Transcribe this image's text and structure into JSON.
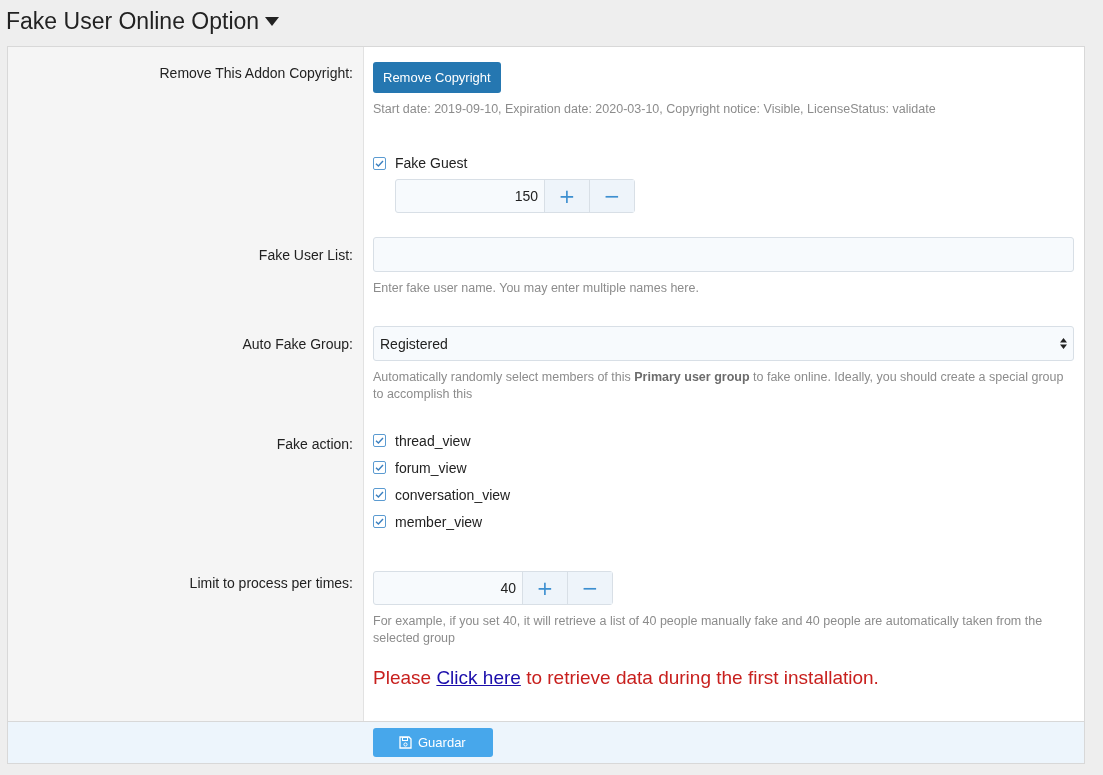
{
  "title": "Fake User Online Option",
  "rows": [
    {
      "kind": "button",
      "label": "Remove This Addon Copyright:",
      "button": "Remove Copyright",
      "hint": "Start date: 2019-09-10, Expiration date: 2020-03-10, Copyright notice: Visible, LicenseStatus: validate"
    },
    {
      "kind": "checkbox_number",
      "checkbox": {
        "label": "Fake Guest",
        "checked": true
      },
      "value": "150",
      "plus": "+",
      "minus": "−"
    },
    {
      "kind": "text",
      "label": "Fake User List:",
      "hint": "Enter fake user name. You may enter multiple names here."
    },
    {
      "kind": "select",
      "label": "Auto Fake Group:",
      "value": "Registered",
      "hint": "Automatically randomly select members of this **Primary user group** to fake online. Ideally, you should create a special group to accomplish this"
    },
    {
      "kind": "checklist",
      "label": "Fake action:",
      "options": [
        {
          "label": "thread_view",
          "checked": true
        },
        {
          "label": "forum_view",
          "checked": true
        },
        {
          "label": "conversation_view",
          "checked": true
        },
        {
          "label": "member_view",
          "checked": true
        }
      ]
    },
    {
      "kind": "number",
      "label": "Limit to process per times:",
      "value": "40",
      "plus": "+",
      "minus": "−",
      "hint": "For example, if you set 40, it will retrieve a list of 40 people manually fake and 40 people are automatically taken from the selected group"
    },
    {
      "kind": "notice",
      "before": "Please ",
      "link": "Click here",
      "after": " to retrieve data during the first installation."
    }
  ],
  "save_button": "Guardar"
}
